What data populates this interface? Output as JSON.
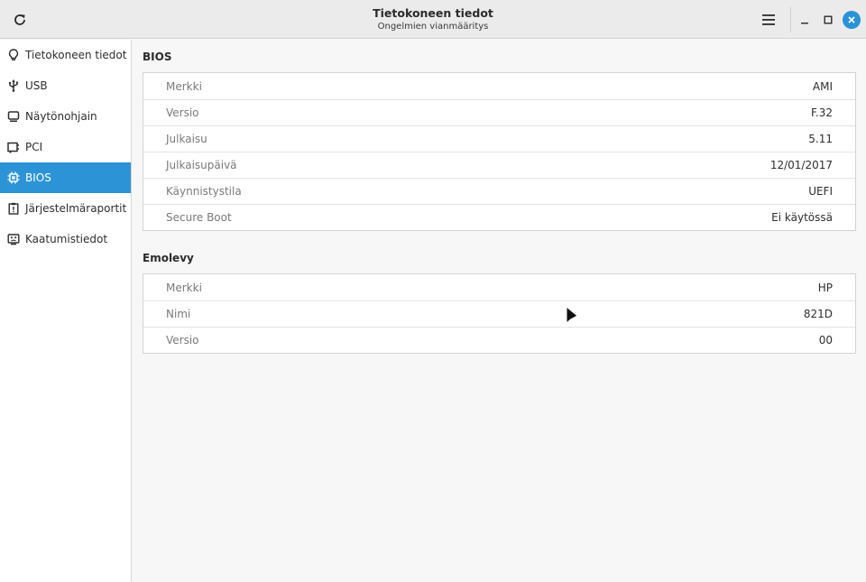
{
  "window": {
    "title": "Tietokoneen tiedot",
    "subtitle": "Ongelmien vianmääritys"
  },
  "sidebar": {
    "items": [
      {
        "label": "Tietokoneen tiedot",
        "icon": "lightbulb-icon"
      },
      {
        "label": "USB",
        "icon": "usb-icon"
      },
      {
        "label": "Näytönohjain",
        "icon": "monitor-icon"
      },
      {
        "label": "PCI",
        "icon": "pci-card-icon"
      },
      {
        "label": "BIOS",
        "icon": "chip-icon",
        "active": true
      },
      {
        "label": "Järjestelmäraportit",
        "icon": "report-icon"
      },
      {
        "label": "Kaatumistiedot",
        "icon": "crash-icon"
      }
    ]
  },
  "bios": {
    "title": "BIOS",
    "rows": [
      {
        "key": "Merkki",
        "value": "AMI"
      },
      {
        "key": "Versio",
        "value": "F.32"
      },
      {
        "key": "Julkaisu",
        "value": "5.11"
      },
      {
        "key": "Julkaisupäivä",
        "value": "12/01/2017"
      },
      {
        "key": "Käynnistystila",
        "value": "UEFI"
      },
      {
        "key": "Secure Boot",
        "value": "Ei käytössä"
      }
    ]
  },
  "motherboard": {
    "title": "Emolevy",
    "rows": [
      {
        "key": "Merkki",
        "value": "HP"
      },
      {
        "key": "Nimi",
        "value": "821D"
      },
      {
        "key": "Versio",
        "value": "00"
      }
    ]
  },
  "colors": {
    "accent": "#2c94d6",
    "close_button": "#2a93d5"
  }
}
